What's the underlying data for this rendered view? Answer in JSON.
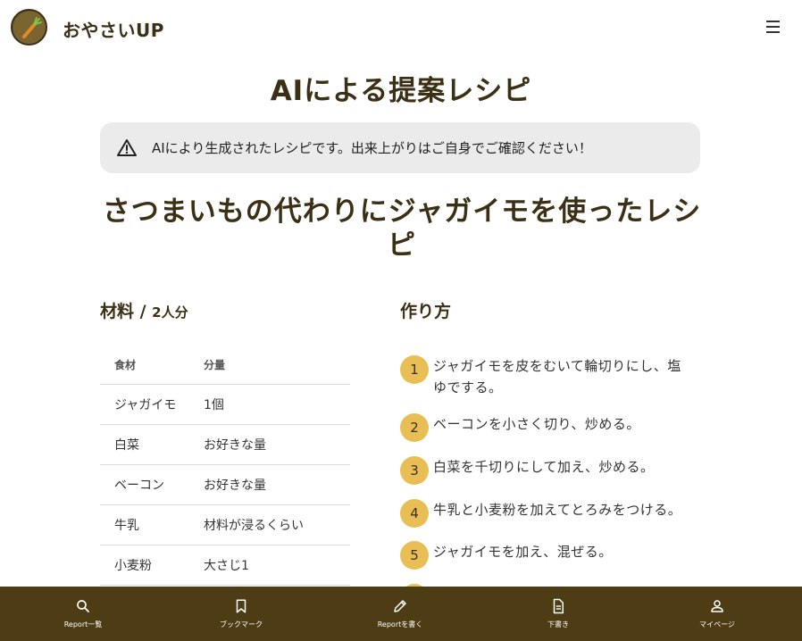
{
  "header": {
    "app_title": "おやさいUP",
    "menu_icon": "hamburger-menu-icon"
  },
  "page_title": "AIによる提案レシピ",
  "notice": {
    "icon": "warning-icon",
    "text": "AIにより生成されたレシピです。出来上がりはご自身でご確認ください！"
  },
  "recipe": {
    "title_line1": "さつまいもの代わりにジャガイモを使ったレシ",
    "title_line2": "ピ"
  },
  "ingredients": {
    "heading": "材料 / ",
    "servings": "2人分",
    "columns": [
      "食材",
      "分量"
    ],
    "rows": [
      [
        "ジャガイモ",
        "1個"
      ],
      [
        "白菜",
        "お好きな量"
      ],
      [
        "ベーコン",
        "お好きな量"
      ],
      [
        "牛乳",
        "材料が浸るくらい"
      ],
      [
        "小麦粉",
        "大さじ1"
      ]
    ]
  },
  "steps": {
    "heading": "作り方",
    "items": [
      {
        "num": "1",
        "line1": "ジャガイモを皮をむいて輪切りにし、塩",
        "line2": "ゆでする。"
      },
      {
        "num": "2",
        "line1": "ベーコンを小さく切り、炒める。",
        "line2": ""
      },
      {
        "num": "3",
        "line1": "白菜を千切りにして加え、炒める。",
        "line2": ""
      },
      {
        "num": "4",
        "line1": "牛乳と小麦粉を加えてとろみをつける。",
        "line2": ""
      },
      {
        "num": "5",
        "line1": "ジャガイモを加え、混ぜる。",
        "line2": ""
      }
    ]
  },
  "bottom_nav": {
    "items": [
      {
        "label": "Report一覧",
        "icon": "search-icon"
      },
      {
        "label": "ブックマーク",
        "icon": "bookmark-icon"
      },
      {
        "label": "Reportを書く",
        "icon": "pencil-icon"
      },
      {
        "label": "下書き",
        "icon": "document-icon"
      },
      {
        "label": "マイページ",
        "icon": "user-icon"
      }
    ]
  },
  "colors": {
    "brand_dark": "#4d3c14",
    "step_badge": "#e9bf55",
    "notice_bg": "#ebebeb"
  }
}
